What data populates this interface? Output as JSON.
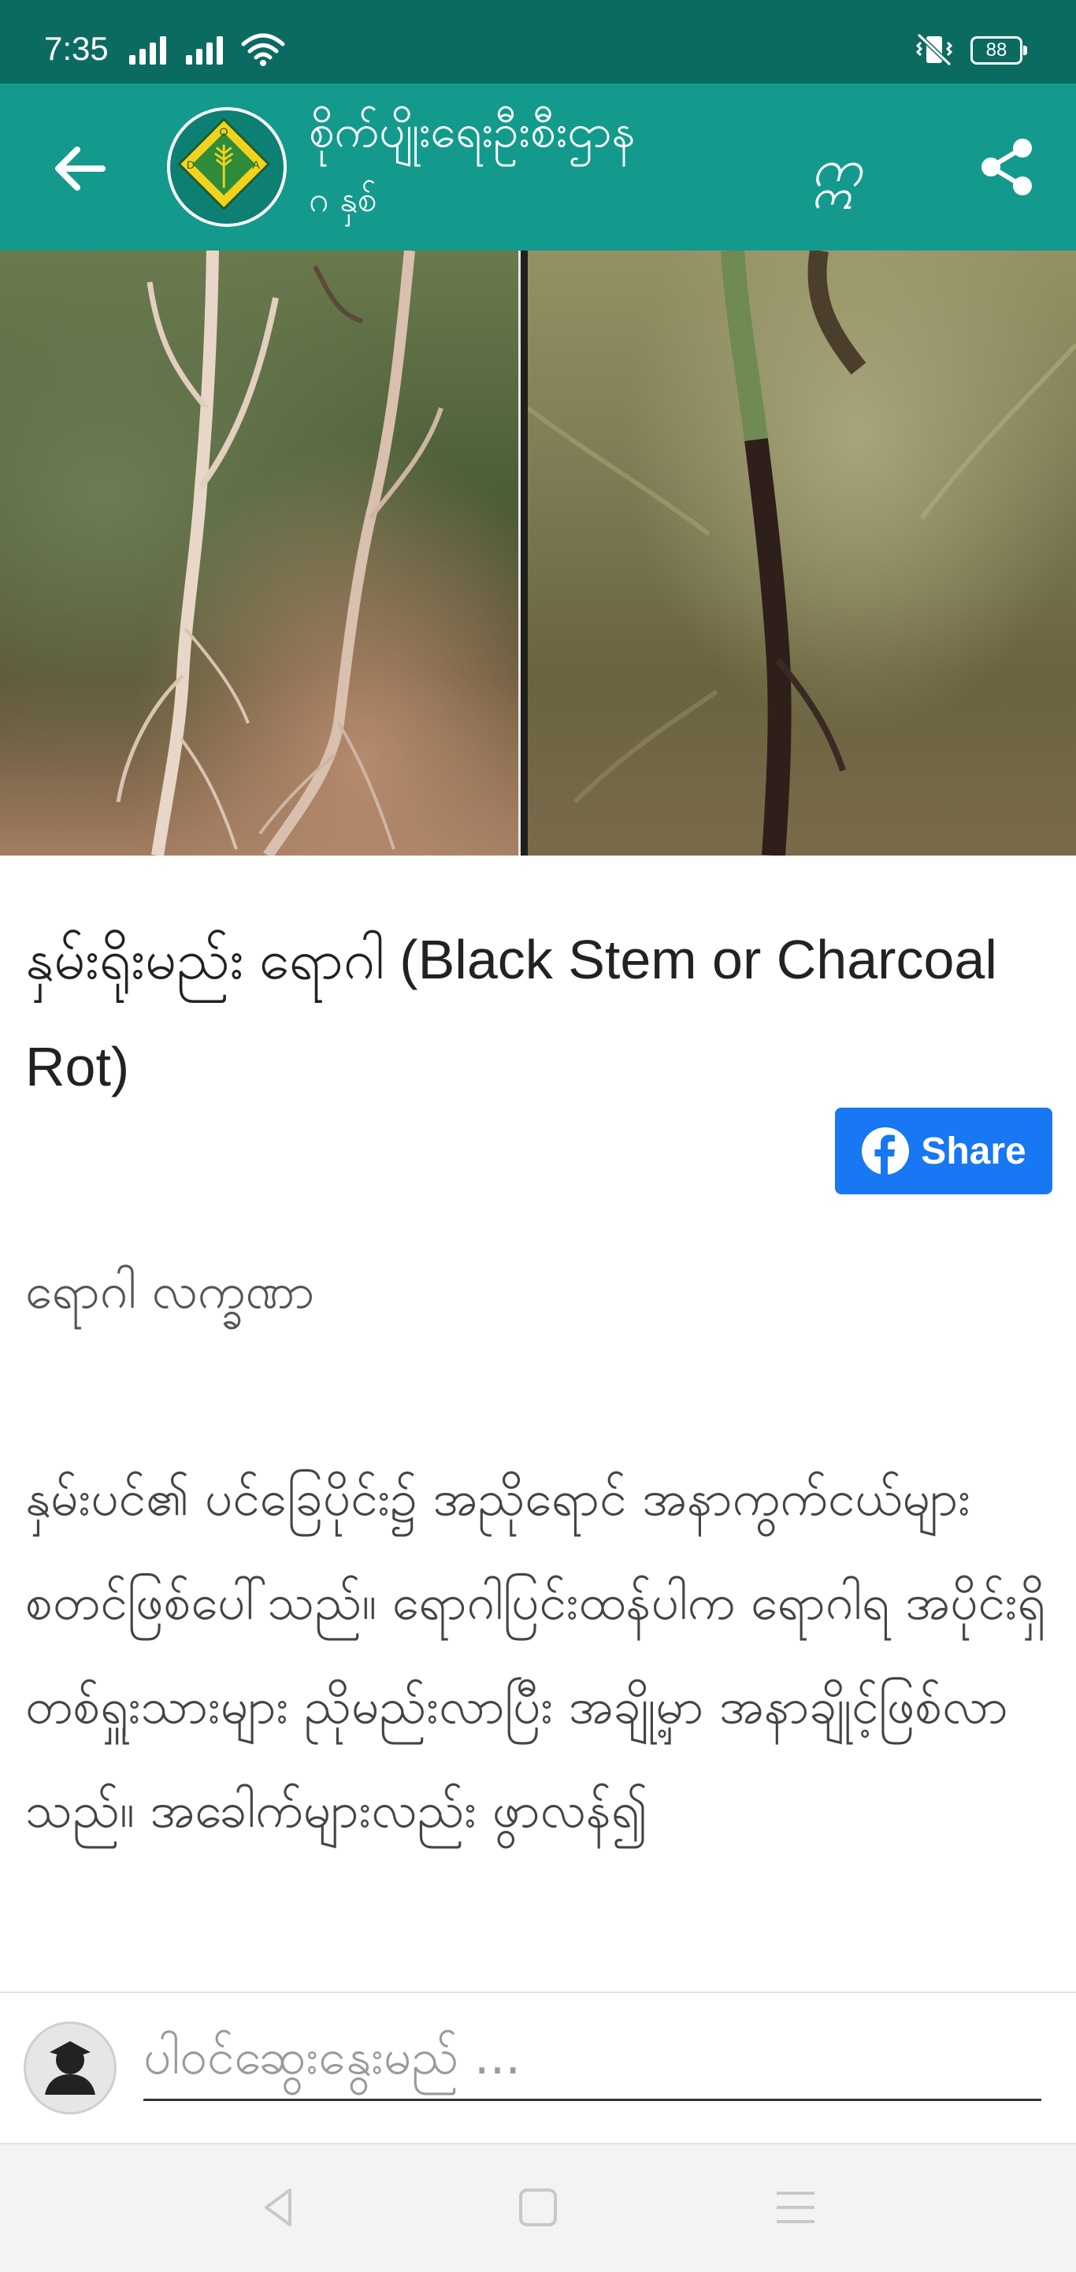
{
  "status_bar": {
    "time": "7:35",
    "battery": "88",
    "icons": [
      "signal-icon",
      "signal-icon",
      "wifi-icon",
      "vibrate-icon",
      "battery-icon"
    ]
  },
  "app_bar": {
    "title": "စိုက်ပျိုးရေးဦးစီးဌာန",
    "subtitle": "ဂ နှစ်",
    "font_toggle": "ဣ",
    "logo_letters": [
      "D",
      "O",
      "A"
    ],
    "icons": [
      "back-arrow-icon",
      "share-icon"
    ]
  },
  "article": {
    "title": "နှမ်းရိုးမည်း ရောဂါ (Black Stem or Charcoal Rot)",
    "fb_share_label": "Share",
    "section_heading": "ရောဂါ လက္ခဏာ",
    "body": "နှမ်းပင်၏ ပင်ခြေပိုင်း၌ အညိုရောင် အနာကွက်ငယ်များ စတင်ဖြစ်ပေါ်သည်။ ရောဂါပြင်းထန်ပါက ရောဂါရ အပိုင်းရှိ တစ်ရှူးသားများ ညိုမည်းလာပြီး အချို့မှာ အနာချိုင့်ဖြစ်လာသည်။ အခေါက်များလည်း ဖွာလန်၍"
  },
  "comment": {
    "placeholder": "ပါဝင်ဆွေးနွေးမည် ..."
  },
  "colors": {
    "status_bar": "#0c6b61",
    "app_bar": "#139a8c",
    "facebook": "#1877f2"
  }
}
